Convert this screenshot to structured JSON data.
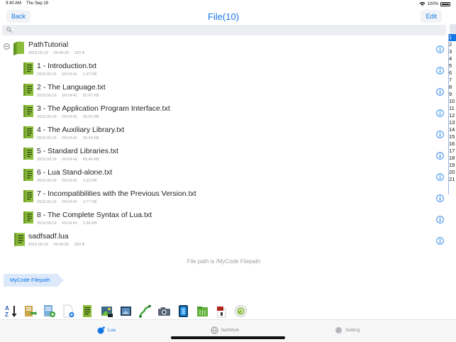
{
  "status": {
    "time": "9:40 AM",
    "date": "Thu Sep 19",
    "battery": "100%"
  },
  "nav": {
    "back": "Back",
    "title": "File(10)",
    "edit": "Edit"
  },
  "search": {
    "placeholder": ""
  },
  "index": [
    "1",
    "2",
    "3",
    "4",
    "5",
    "6",
    "7",
    "8",
    "9",
    "10",
    "11",
    "12",
    "13",
    "14",
    "15",
    "16",
    "17",
    "18",
    "19",
    "20",
    "21"
  ],
  "files": [
    {
      "name": "PathTutorial",
      "date": "2019.09.19",
      "time": "09:40:29",
      "size": "320 B",
      "kind": "folder"
    },
    {
      "name": "1 - Introduction.txt",
      "date": "2019.09.19",
      "time": "09:24:41",
      "size": "1.57 KB",
      "kind": "file"
    },
    {
      "name": "2 - The Language.txt",
      "date": "2019.09.19",
      "time": "09:24:41",
      "size": "52.67 KB",
      "kind": "file"
    },
    {
      "name": "3 - The Application Program Interface.txt",
      "date": "2019.09.19",
      "time": "09:24:41",
      "size": "60.52 KB",
      "kind": "file"
    },
    {
      "name": "4 - The Auxiliary Library.txt",
      "date": "2019.09.19",
      "time": "09:24:41",
      "size": "20.43 KB",
      "kind": "file"
    },
    {
      "name": "5 - Standard Libraries.txt",
      "date": "2019.09.19",
      "time": "09:24:41",
      "size": "65.46 KB",
      "kind": "file"
    },
    {
      "name": "6 - Lua Stand-alone.txt",
      "date": "2019.09.19",
      "time": "09:24:41",
      "size": "3.32 KB",
      "kind": "file"
    },
    {
      "name": "7 - Incompatibilities with the Previous Version.txt",
      "date": "2019.09.19",
      "time": "09:24:41",
      "size": "2.77 KB",
      "kind": "file"
    },
    {
      "name": "8 - The Complete Syntax of Lua.txt",
      "date": "2019.09.19",
      "time": "09:24:41",
      "size": "1.54 KB",
      "kind": "file"
    },
    {
      "name": "sadfsadf.lua",
      "date": "2019.09.19",
      "time": "09:40:26",
      "size": "583 B",
      "kind": "file"
    }
  ],
  "footer_note": "File path is /MyCode Filepath",
  "breadcrumb": "MyCode Filepath",
  "toolbar_icons": [
    "sort-az-icon",
    "move-file-icon",
    "add-file-icon",
    "new-file-icon",
    "document-icon",
    "image-icon",
    "image-frame-icon",
    "path-icon",
    "camera-icon",
    "film-icon",
    "grid-folder-icon",
    "archive-icon",
    "recycle-icon"
  ],
  "tabs": [
    {
      "label": "Lua",
      "icon": "lua-icon"
    },
    {
      "label": "NetWork",
      "icon": "globe-icon"
    },
    {
      "label": "Setting",
      "icon": "gear-icon"
    }
  ],
  "colors": {
    "accent": "#1576e6",
    "file_green": "#8bbd3a",
    "text": "#1f2024",
    "meta": "#9a9ea5"
  }
}
